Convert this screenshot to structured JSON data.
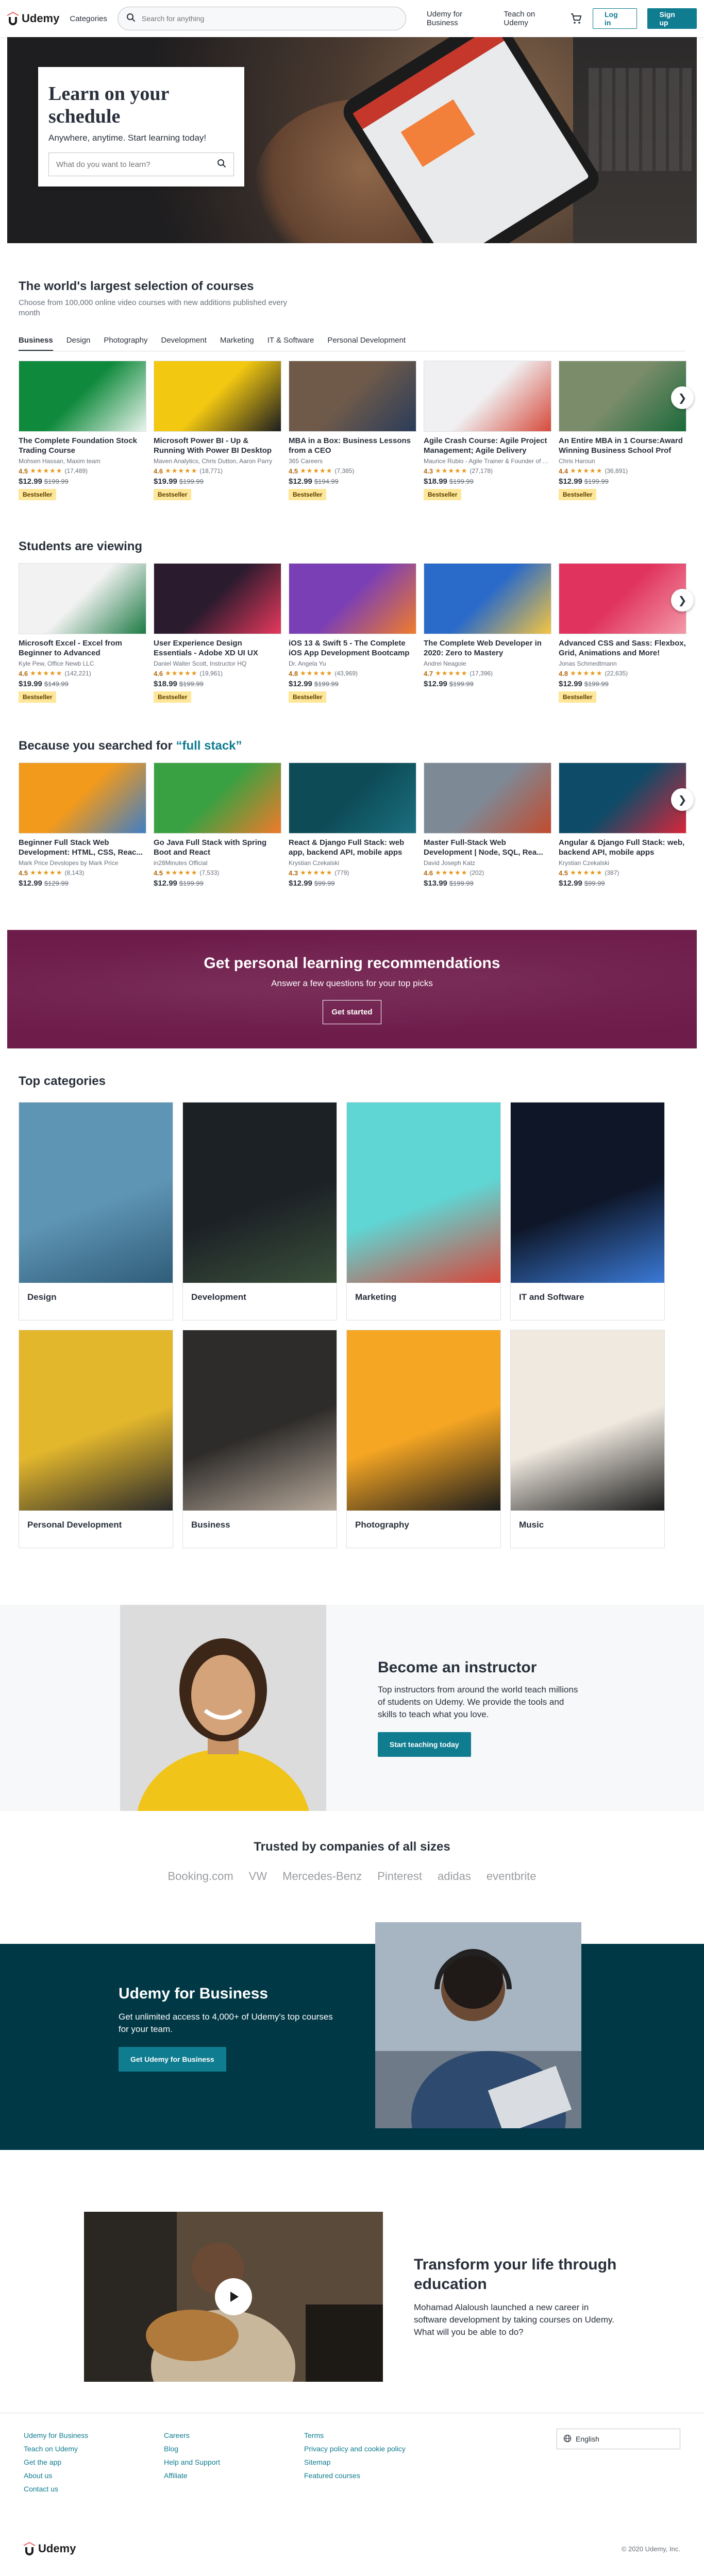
{
  "header": {
    "logo_text": "Udemy",
    "categories": "Categories",
    "search_placeholder": "Search for anything",
    "udemy_for_business": "Udemy for Business",
    "teach_on_udemy": "Teach on Udemy",
    "login": "Log in",
    "signup": "Sign up"
  },
  "hero": {
    "title": "Learn on your schedule",
    "subtitle": "Anywhere, anytime. Start learning today!",
    "search_placeholder": "What do you want to learn?"
  },
  "largest": {
    "title": "The world's largest selection of courses",
    "subtitle": "Choose from 100,000 online video courses with new additions published every month",
    "tabs": [
      "Business",
      "Design",
      "Photography",
      "Development",
      "Marketing",
      "IT & Software",
      "Personal Development"
    ],
    "cards": [
      {
        "title": "The Complete Foundation Stock Trading Course",
        "author": "Mohsen Hassan, Maxim team",
        "rating": "4.5",
        "count": "(17,489)",
        "price": "$12.99",
        "old": "$199.99",
        "badge": "Bestseller",
        "c1": "#0f8a3c",
        "c2": "#e9f4ec"
      },
      {
        "title": "Microsoft Power BI - Up & Running With Power BI Desktop",
        "author": "Maven Analytics, Chris Dutton, Aaron Parry",
        "rating": "4.6",
        "count": "(18,771)",
        "price": "$19.99",
        "old": "$199.99",
        "badge": "Bestseller",
        "c1": "#f2c811",
        "c2": "#1c1d1f"
      },
      {
        "title": "MBA in a Box: Business Lessons from a CEO",
        "author": "365 Careers",
        "rating": "4.5",
        "count": "(7,385)",
        "price": "$12.99",
        "old": "$194.99",
        "badge": "Bestseller",
        "c1": "#6f5a4a",
        "c2": "#2a3c5a"
      },
      {
        "title": "Agile Crash Course: Agile Project Management; Agile Delivery",
        "author": "Maurice Rubio - Agile Trainer & Founder of A...",
        "rating": "4.3",
        "count": "(27,178)",
        "price": "$18.99",
        "old": "$199.99",
        "badge": "Bestseller",
        "c1": "#f0f0f2",
        "c2": "#d64a3b"
      },
      {
        "title": "An Entire MBA in 1 Course:Award Winning Business School Prof",
        "author": "Chris Haroun",
        "rating": "4.4",
        "count": "(36,891)",
        "price": "$12.99",
        "old": "$199.99",
        "badge": "Bestseller",
        "c1": "#7a8c6a",
        "c2": "#1a6a3a"
      }
    ]
  },
  "viewing": {
    "title": "Students are viewing",
    "cards": [
      {
        "title": "Microsoft Excel - Excel from Beginner to Advanced",
        "author": "Kyle Pew, Office Newb LLC",
        "rating": "4.6",
        "count": "(142,221)",
        "price": "$19.99",
        "old": "$149.99",
        "badge": "Bestseller",
        "c1": "#f2f2f2",
        "c2": "#1d7a45"
      },
      {
        "title": "User Experience Design Essentials - Adobe XD UI UX Design",
        "author": "Daniel Walter Scott, Instructor HQ",
        "rating": "4.6",
        "count": "(19,961)",
        "price": "$18.99",
        "old": "$199.99",
        "badge": "Bestseller",
        "c1": "#2b1b2e",
        "c2": "#e6385c"
      },
      {
        "title": "iOS 13 & Swift 5 - The Complete iOS App Development Bootcamp",
        "author": "Dr. Angela Yu",
        "rating": "4.8",
        "count": "(43,969)",
        "price": "$12.99",
        "old": "$199.99",
        "badge": "Bestseller",
        "c1": "#7b3fb5",
        "c2": "#f07c2c"
      },
      {
        "title": "The Complete Web Developer in 2020: Zero to Mastery",
        "author": "Andrei Neagoie",
        "rating": "4.7",
        "count": "(17,396)",
        "price": "$12.99",
        "old": "$199.99",
        "badge": "",
        "c1": "#2a6ac8",
        "c2": "#f4c542"
      },
      {
        "title": "Advanced CSS and Sass: Flexbox, Grid, Animations and More!",
        "author": "Jonas Schmedtmann",
        "rating": "4.8",
        "count": "(22,635)",
        "price": "$12.99",
        "old": "$199.99",
        "badge": "Bestseller",
        "c1": "#e0335e",
        "c2": "#f39aa8"
      }
    ]
  },
  "searched": {
    "title_prefix": "Because you searched for ",
    "query": "“full stack”",
    "cards": [
      {
        "title": "Beginner Full Stack Web Development: HTML, CSS, Reac...",
        "author": "Mark Price Devslopes by Mark Price",
        "rating": "4.5",
        "count": "(8,143)",
        "price": "$12.99",
        "old": "$129.99",
        "badge": "",
        "c1": "#f29a1c",
        "c2": "#3f7ec4"
      },
      {
        "title": "Go Java Full Stack with Spring Boot and React",
        "author": "in28Minutes Official",
        "rating": "4.5",
        "count": "(7,533)",
        "price": "$12.99",
        "old": "$199.99",
        "badge": "",
        "c1": "#3aa142",
        "c2": "#f07a2a"
      },
      {
        "title": "React & Django Full Stack: web app, backend API, mobile apps",
        "author": "Krystian Czekalski",
        "rating": "4.3",
        "count": "(779)",
        "price": "$12.99",
        "old": "$99.99",
        "badge": "",
        "c1": "#0d4b56",
        "c2": "#1b6f80"
      },
      {
        "title": "Master Full-Stack Web Development | Node, SQL, Rea...",
        "author": "David Joseph Katz",
        "rating": "4.6",
        "count": "(202)",
        "price": "$13.99",
        "old": "$199.99",
        "badge": "",
        "c1": "#7d8a96",
        "c2": "#c24b2f"
      },
      {
        "title": "Angular & Django Full Stack: web, backend API, mobile apps",
        "author": "Krystian Czekalski",
        "rating": "4.5",
        "count": "(387)",
        "price": "$12.99",
        "old": "$99.99",
        "badge": "",
        "c1": "#0d4b68",
        "c2": "#d8263a"
      }
    ]
  },
  "promo": {
    "title": "Get personal learning recommendations",
    "subtitle": "Answer a few questions for your top picks",
    "button": "Get started"
  },
  "categories": {
    "title": "Top categories",
    "items": [
      {
        "label": "Design",
        "c1": "#5f95b4",
        "c2": "#2f5d7a"
      },
      {
        "label": "Development",
        "c1": "#1c2126",
        "c2": "#3a4f3a"
      },
      {
        "label": "Marketing",
        "c1": "#5fd6d4",
        "c2": "#d8463a"
      },
      {
        "label": "IT and Software",
        "c1": "#0e1628",
        "c2": "#3a7ad6"
      },
      {
        "label": "Personal Development",
        "c1": "#e3b72c",
        "c2": "#2a2a2a"
      },
      {
        "label": "Business",
        "c1": "#2e2c2a",
        "c2": "#b6a89a"
      },
      {
        "label": "Photography",
        "c1": "#f5a623",
        "c2": "#1c1c1c"
      },
      {
        "label": "Music",
        "c1": "#efe9df",
        "c2": "#1c1c1c"
      }
    ]
  },
  "instructor": {
    "title": "Become an instructor",
    "text": "Top instructors from around the world teach millions of students on Udemy. We provide the tools and skills to teach what you love.",
    "button": "Start teaching today"
  },
  "trusted": {
    "title": "Trusted by companies of all sizes",
    "logos": [
      "Booking.com",
      "VW",
      "Mercedes-Benz",
      "Pinterest",
      "adidas",
      "eventbrite"
    ]
  },
  "business": {
    "title": "Udemy for Business",
    "text": "Get unlimited access to 4,000+ of Udemy's top courses for your team.",
    "button": "Get Udemy for Business"
  },
  "transform": {
    "title": "Transform your life through education",
    "text": "Mohamad Alaloush launched a new career in software development by taking courses on Udemy. What will you be able to do?"
  },
  "footer": {
    "col1": [
      "Udemy for Business",
      "Teach on Udemy",
      "Get the app",
      "About us",
      "Contact us"
    ],
    "col2": [
      "Careers",
      "Blog",
      "Help and Support",
      "Affiliate"
    ],
    "col3": [
      "Terms",
      "Privacy policy and cookie policy",
      "Sitemap",
      "Featured courses"
    ],
    "language": "English",
    "logo_text": "Udemy",
    "copyright": "© 2020 Udemy, Inc."
  },
  "colors": {
    "accent": "#0f7c90",
    "brand_red": "#ec5252",
    "promo_purple": "#6e1c4a",
    "business_teal": "#003845",
    "badge_yellow": "#ffe799"
  }
}
